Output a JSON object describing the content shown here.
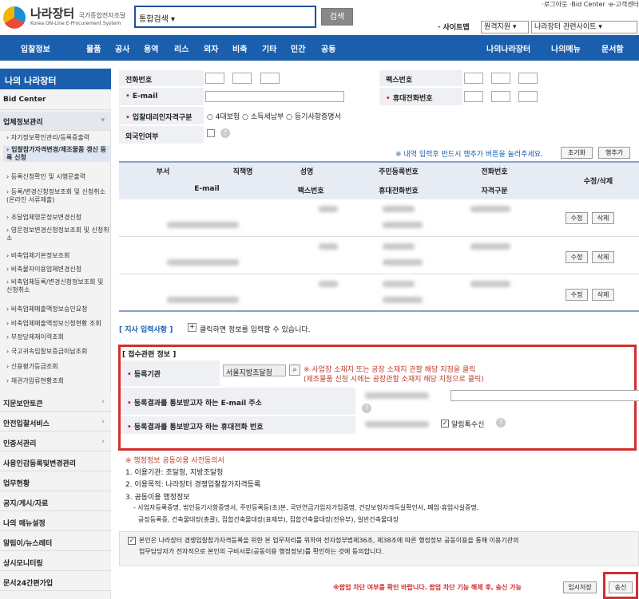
{
  "header": {
    "logo_title": "나라장터",
    "logo_caption": "국가종합전자조달",
    "logo_sub": "Korea ON-Line E-Procurement System",
    "search_select": "통합검색",
    "search_button": "검색",
    "top_links": "·로그아웃  ·Bid Center  ·e-고객센터",
    "sitemap_label": "· 사이트맵",
    "remote_support": "원격지원",
    "related_site": "나라장터 관련사이트"
  },
  "nav": {
    "items": [
      "입찰정보",
      "물품",
      "공사",
      "용역",
      "리스",
      "외자",
      "비축",
      "기타",
      "민간",
      "공동"
    ],
    "right": [
      "나의나라장터",
      "나의메뉴",
      "문서함"
    ]
  },
  "sidebar": {
    "title": "나의 나라장터",
    "bid_center": "Bid Center",
    "section": "업체정보관리",
    "sub_items": [
      "› 자기정보확인관리/등록증출력",
      "› 입찰참가자격변경/제조물품 갱신 등록 신청",
      "› 등록신청확인 및 시행문출력",
      "› 등록/변경신청정보조회 및 신청취소(온라인 서류제출)",
      "› 조달업체영문정보변경신청",
      "› 영문정보변경신청정보조회 및 신청취소",
      "› 비축업체기본정보조회",
      "› 비축물자이용업체변경신청",
      "› 비축업체등록/변경신청정보조회 및 신청취소",
      "› 비축업체매출액정보승인요청",
      "› 비축업체매출액정보신청현황 조회",
      "› 부정당제재이력조회",
      "› 국고귀속입찰보증금미납조회",
      "› 신용평가등급조회",
      "› 채권가압류현황조회"
    ],
    "bold_items": [
      "지문보안토큰",
      "안전입찰서비스",
      "인증서관리",
      "사용인감등록및변경관리",
      "업무현황",
      "공지/게시/자료",
      "나의 메뉴설정",
      "알림이/뉴스레터",
      "상시모니터링",
      "문서24간편가입"
    ]
  },
  "form": {
    "phone_label": "전화번호",
    "fax_label": "팩스번호",
    "email_label": "E-mail",
    "mobile_label": "휴대전화번호",
    "proxy_label": "입찰대리인자격구분",
    "proxy_options": [
      "4대보험",
      "소득세납부",
      "등기사항증명서"
    ],
    "foreigner_label": "외국인여부",
    "notice": "※ 내역 입력후 반드시 행추가 버튼을 눌러주세요.",
    "reset_button": "초기화",
    "add_row_button": "행추가"
  },
  "table": {
    "headers_row1": [
      "부서",
      "직책명",
      "성명",
      "주민등록번호",
      "전화번호",
      "수정/삭제"
    ],
    "headers_row2": [
      "E-mail",
      "팩스번호",
      "휴대전화번호",
      "자격구분"
    ],
    "edit_label": "수정",
    "delete_label": "삭제"
  },
  "branch": {
    "label": "[ 지사 입력사항 ]",
    "hint": "클릭하면 정보를 입력할 수 있습니다."
  },
  "receipt": {
    "title": "[ 접수관련 정보 ]",
    "agency_label": "등록기관",
    "agency_value": "서울지방조달청",
    "agency_note1": "※ 사업장 소재지 또는 공장 소재지 관할 해당 지청을 클릭",
    "agency_note2": "(제조물품 신청 시에는 공장관할 소재지 해당 지청으로 클릭)",
    "email_label": "등록결과를 통보받고자 하는 E-mail 주소",
    "mobile_label": "등록결과를 통보받고자 하는 휴대전화 번호",
    "kakao_label": "알림톡수신"
  },
  "consent": {
    "title": "※ 행정정보 공동이용 사전동의서",
    "lines": [
      "1. 이용기관: 조달청, 지방조달청",
      "2. 이용목적: 나라장터 경쟁입찰참가자격등록",
      "3. 공동이용 행정정보"
    ],
    "docs1": "- 사업자등록증명, 법인등기사항증명서, 주민등록등(초)본, 국민연금가입자가입증명, 건강보험자격득실확인서, 폐업·휴업사실증명,",
    "docs2": "공장등록증, 건축물대장(총괄), 집합건축물대장(표제부), 집합건축물대장(전유부), 일반건축물대장",
    "agree1": "본인은 나라장터 경쟁입찰참가자격등록을 위한 본 업무처리를 위하여 전자정부법제36조, 제38조에 따른 행정정보 공동이용을 통해 이용기관의",
    "agree2": "업무담당자가 전자적으로 본인의 구비서류(공동이용 행정정보)를 확인하는 것에 동의합니다."
  },
  "footer": {
    "popup_notice": "※팝업 차단 여부를 확인 바랍니다. 팝업 차단 기능 해제 후, 송신 가능",
    "save_button": "임시저장",
    "send_button": "송신"
  }
}
